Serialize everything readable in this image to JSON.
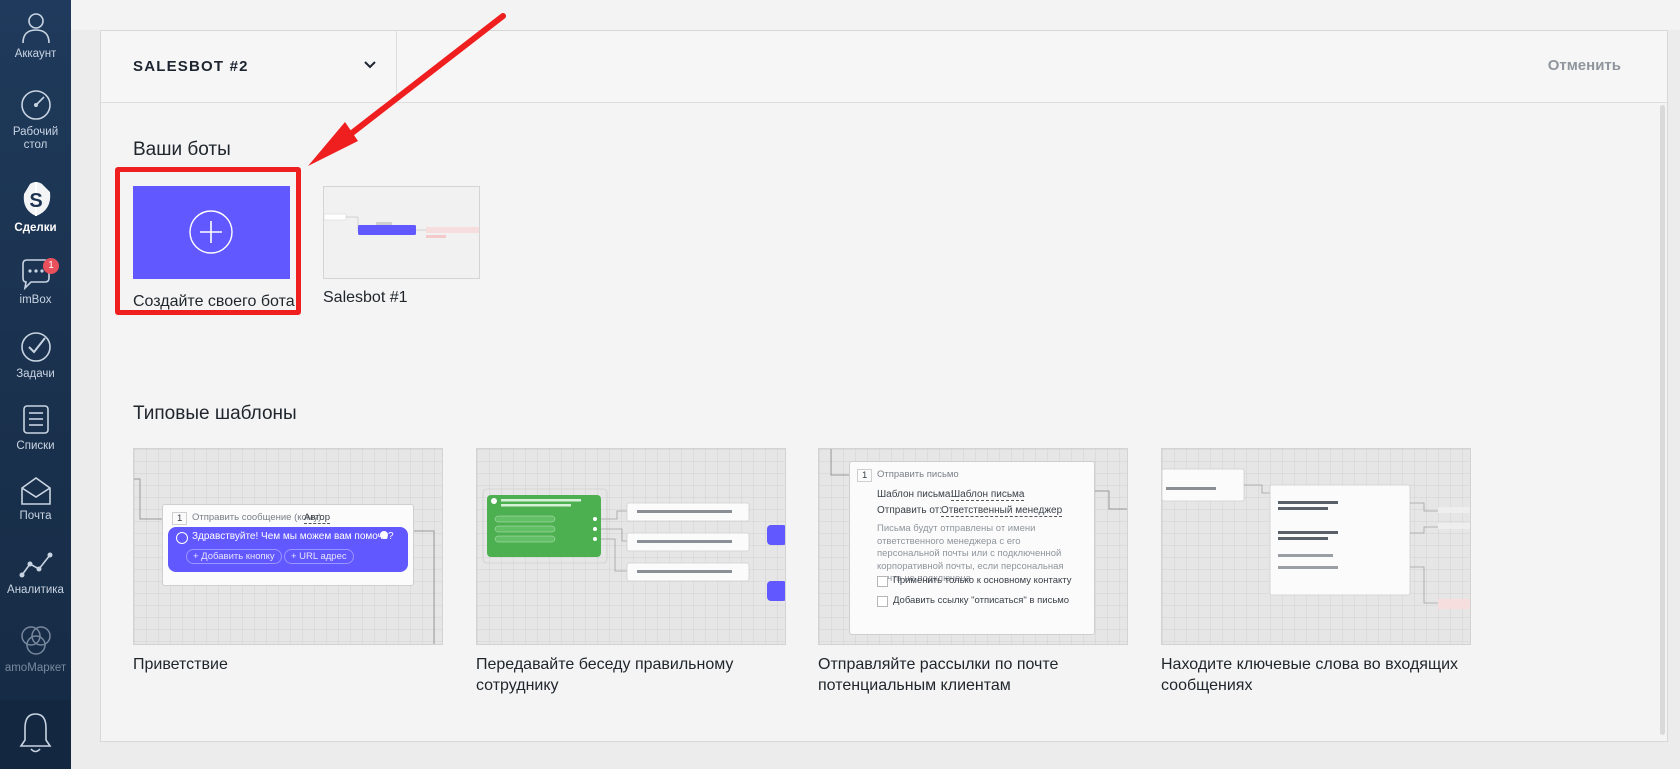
{
  "sidebar": {
    "items": [
      {
        "label": "Аккаунт",
        "icon": "avatar-icon"
      },
      {
        "label": "Рабочий стол",
        "icon": "dashboard-gauge-icon"
      },
      {
        "label": "Сделки",
        "icon": "dollar-icon"
      },
      {
        "label": "imBox",
        "icon": "chat-icon",
        "badge": "1"
      },
      {
        "label": "Задачи",
        "icon": "checkmark-icon"
      },
      {
        "label": "Списки",
        "icon": "list-icon"
      },
      {
        "label": "Почта",
        "icon": "mail-icon"
      },
      {
        "label": "Аналитика",
        "icon": "analytics-icon"
      },
      {
        "label": "amoМаркет",
        "icon": "market-icon"
      }
    ],
    "bottom_icon": "bell-icon"
  },
  "modal": {
    "bot_select": "SALESBOT #2",
    "cancel": "Отменить",
    "your_bots_title": "Ваши боты",
    "create_label": "Создайте своего бота",
    "bots": [
      {
        "name": "Salesbot #1"
      }
    ],
    "templates_title": "Типовые шаблоны",
    "templates": [
      {
        "label": "Приветствие",
        "preview": {
          "step_num": "1",
          "step_text": "Отправить сообщение (кому):",
          "step_value": "Автор",
          "message": "Здравствуйте! Чем мы можем вам помочь?",
          "add_button": "+ Добавить кнопку",
          "url_button": "+ URL адрес"
        }
      },
      {
        "label": "Передавайте беседу правильному сотруднику"
      },
      {
        "label": "Отправляйте рассылки по почте потенциальным клиентам",
        "preview": {
          "step_num": "1",
          "step_text": "Отправить письмо",
          "template_label": "Шаблон письма:",
          "template_value": "Шаблон письма",
          "from_label": "Отправить от:",
          "from_value": "Ответственный менеджер",
          "hint": "Письма будут отправлены от имени ответственного менеджера с его персональной почты или с подключенной корпоративной почты, если персональная почта не подключена",
          "checkbox1": "Применить только к основному контакту",
          "checkbox2": "Добавить ссылку \"отписаться\" в письмо"
        }
      },
      {
        "label": "Находите ключевые слова во входящих сообщениях"
      }
    ]
  },
  "colors": {
    "accent": "#6258ff",
    "highlight": "#ef1f1f",
    "green": "#4caf50",
    "sidebar": "#1b3350"
  }
}
